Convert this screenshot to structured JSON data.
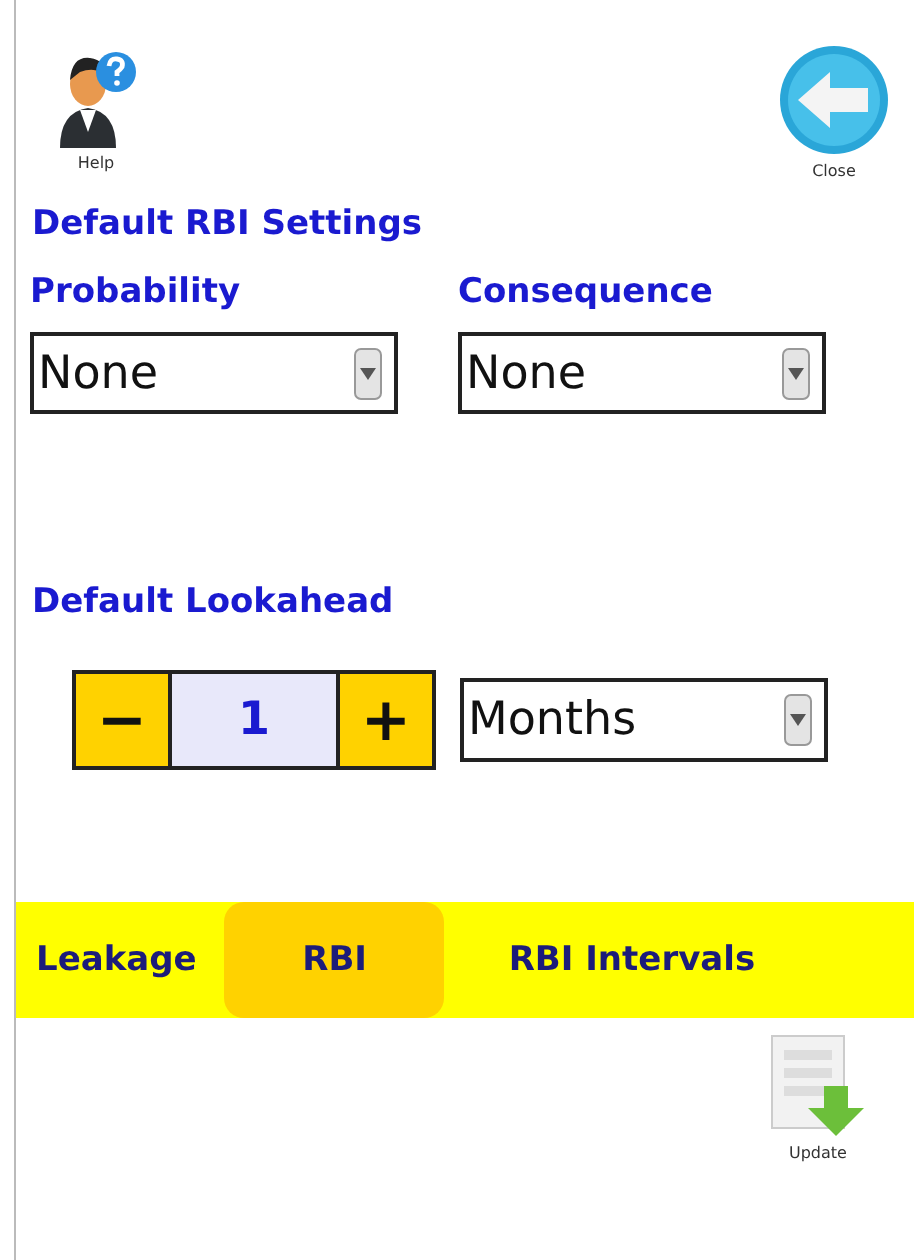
{
  "toolbar": {
    "help": "Help",
    "close": "Close"
  },
  "rbi_settings": {
    "title": "Default RBI Settings",
    "fields": [
      {
        "label": "Probability",
        "value": "None"
      },
      {
        "label": "Consequence",
        "value": "None"
      }
    ]
  },
  "lookahead": {
    "title": "Default Lookahead",
    "decrement": "−",
    "value": "1",
    "increment": "+",
    "unit": "Months"
  },
  "tabs": [
    {
      "label": "Leakage",
      "selected": false
    },
    {
      "label": "RBI",
      "selected": true
    },
    {
      "label": "RBI Intervals",
      "selected": false
    }
  ],
  "update": "Update"
}
